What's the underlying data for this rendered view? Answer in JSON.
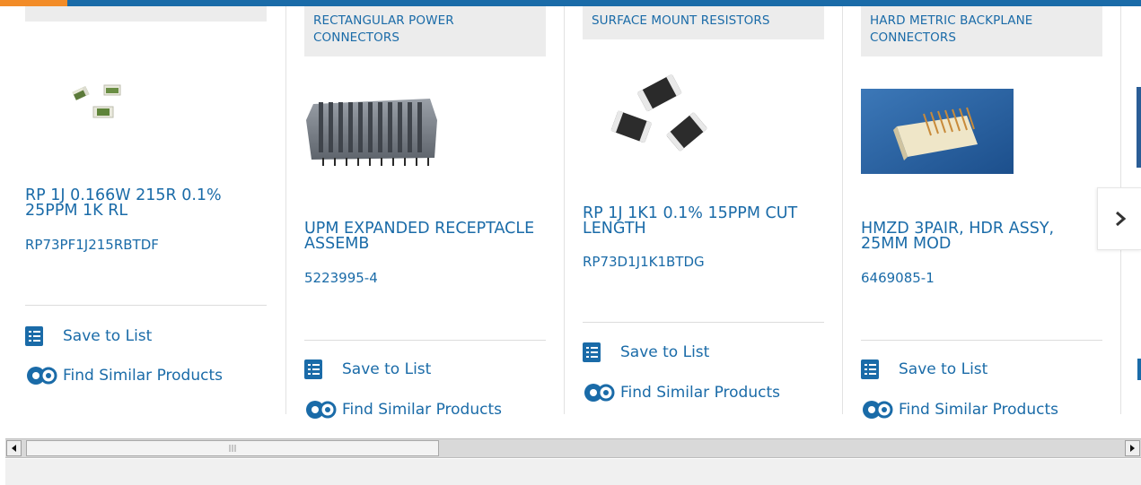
{
  "colors": {
    "accent": "#1a6ba8",
    "orange": "#f28c28",
    "category_bg": "#ececec"
  },
  "cards": [
    {
      "category": "",
      "name": "RP 1J 0.166W 215R 0.1% 25PPM 1K RL",
      "part_number": "RP73PF1J215RBTDF",
      "save_label": "Save to List",
      "similar_label": "Find Similar Products"
    },
    {
      "category": "RECTANGULAR POWER CONNECTORS",
      "name": "UPM EXPANDED RECEPTACLE ASSEMB",
      "part_number": "5223995-4",
      "save_label": "Save to List",
      "similar_label": "Find Similar Products"
    },
    {
      "category": "SURFACE MOUNT RESISTORS",
      "name": "RP 1J 1K1 0.1% 15PPM CUT LENGTH",
      "part_number": "RP73D1J1K1BTDG",
      "save_label": "Save to List",
      "similar_label": "Find Similar Products"
    },
    {
      "category": "HARD METRIC BACKPLANE CONNECTORS",
      "name": "HMZD 3PAIR, HDR ASSY, 25MM MOD",
      "part_number": "6469085-1",
      "save_label": "Save to List",
      "similar_label": "Find Similar Products"
    }
  ],
  "icons": {
    "list": "checklist-icon",
    "similar": "gears-icon",
    "next": "chevron-right-icon"
  }
}
